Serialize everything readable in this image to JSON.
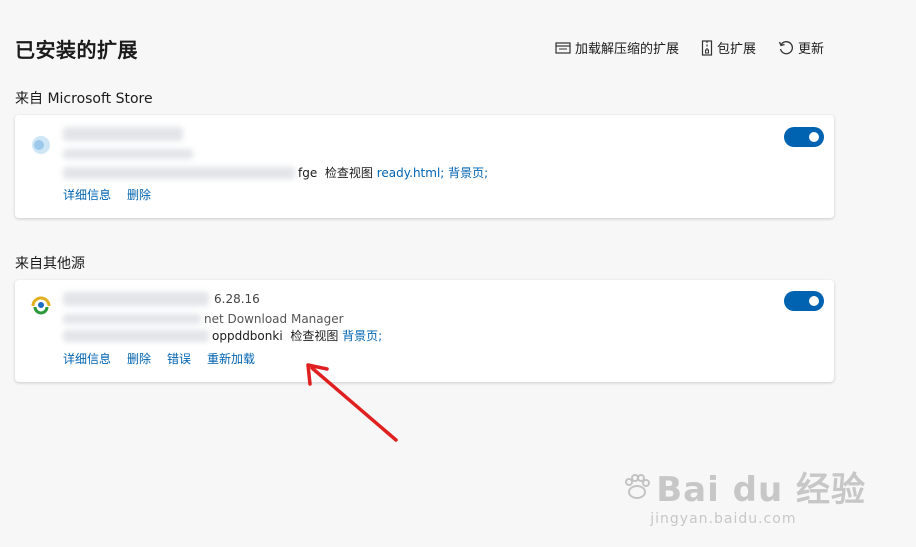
{
  "header": {
    "title": "已安装的扩展",
    "load_unpacked": "加载解压缩的扩展",
    "pack_extension": "包扩展",
    "update": "更新"
  },
  "sections": [
    {
      "label": "来自 Microsoft Store",
      "extension": {
        "id_suffix": "fge",
        "inspect_label": "检查视图",
        "inspect_links": "ready.html; 背景页;",
        "enabled": true,
        "actions": [
          "详细信息",
          "删除"
        ]
      }
    },
    {
      "label": "来自其他源",
      "extension": {
        "version": "6.28.16",
        "description": "net Download Manager",
        "id_suffix": "oppddbonki",
        "inspect_label": "检查视图",
        "inspect_links": "背景页;",
        "enabled": true,
        "actions": [
          "详细信息",
          "删除",
          "错误",
          "重新加载"
        ]
      }
    }
  ],
  "colors": {
    "accent": "#0063b1",
    "arrow": "#e02020",
    "background": "#f7f7f7"
  },
  "watermark": {
    "main": "Bai du 经验",
    "sub": "jingyan.baidu.com"
  }
}
